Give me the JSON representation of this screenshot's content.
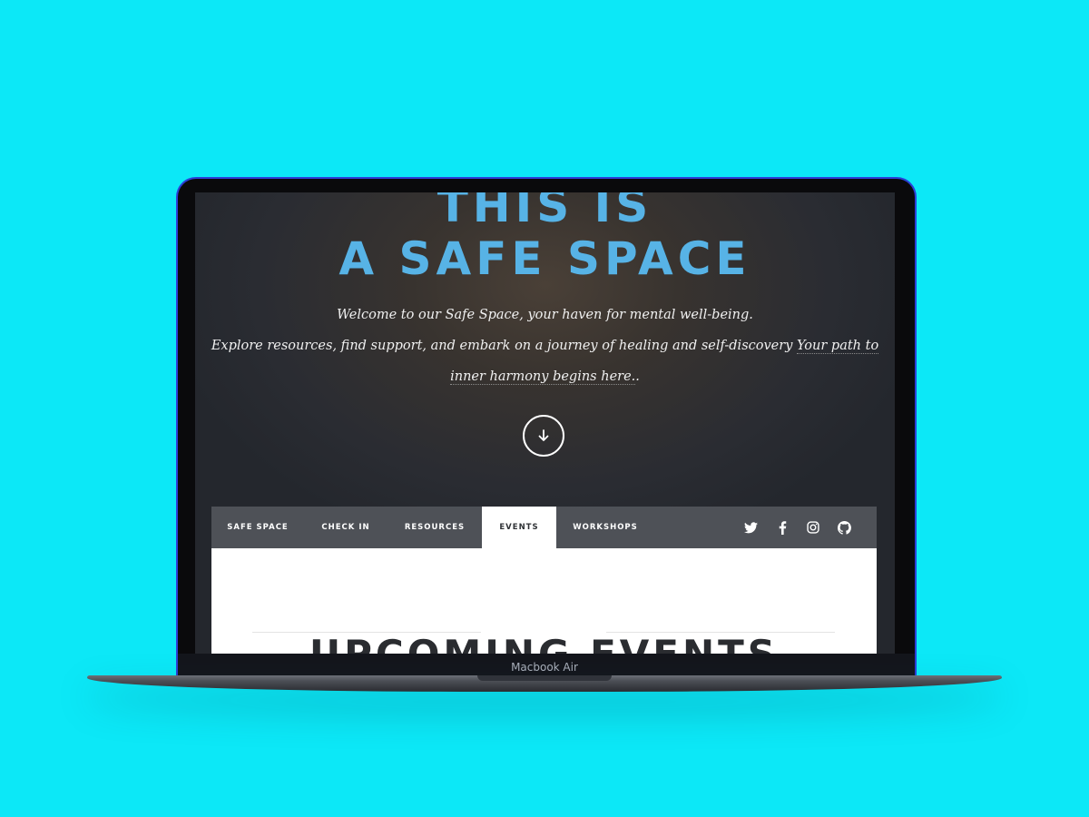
{
  "hero": {
    "title_line1": "THIS IS",
    "title_line2": "A SAFE SPACE",
    "line1": "Welcome to our Safe Space, your haven for mental well-being.",
    "line2_text": "Explore resources, find support, and embark on a journey of healing and self-discovery ",
    "line2_link": "Your path to",
    "line3_link": "inner harmony begins here.",
    "line3_suffix": ".",
    "scroll_icon": "arrow-down-icon"
  },
  "nav": {
    "items": [
      {
        "label": "SAFE SPACE",
        "active": false
      },
      {
        "label": "CHECK IN",
        "active": false
      },
      {
        "label": "RESOURCES",
        "active": false
      },
      {
        "label": "EVENTS",
        "active": true
      },
      {
        "label": "WORKSHOPS",
        "active": false
      }
    ],
    "social": [
      "twitter-icon",
      "facebook-icon",
      "instagram-icon",
      "github-icon"
    ]
  },
  "section": {
    "title": "UPCOMING EVENTS"
  },
  "device": {
    "label": "Macbook Air"
  },
  "colors": {
    "background": "#0ce8f7",
    "title_blue": "#57b3e6",
    "nav_bg": "#4e5157",
    "text_dark": "#2a2c30"
  }
}
